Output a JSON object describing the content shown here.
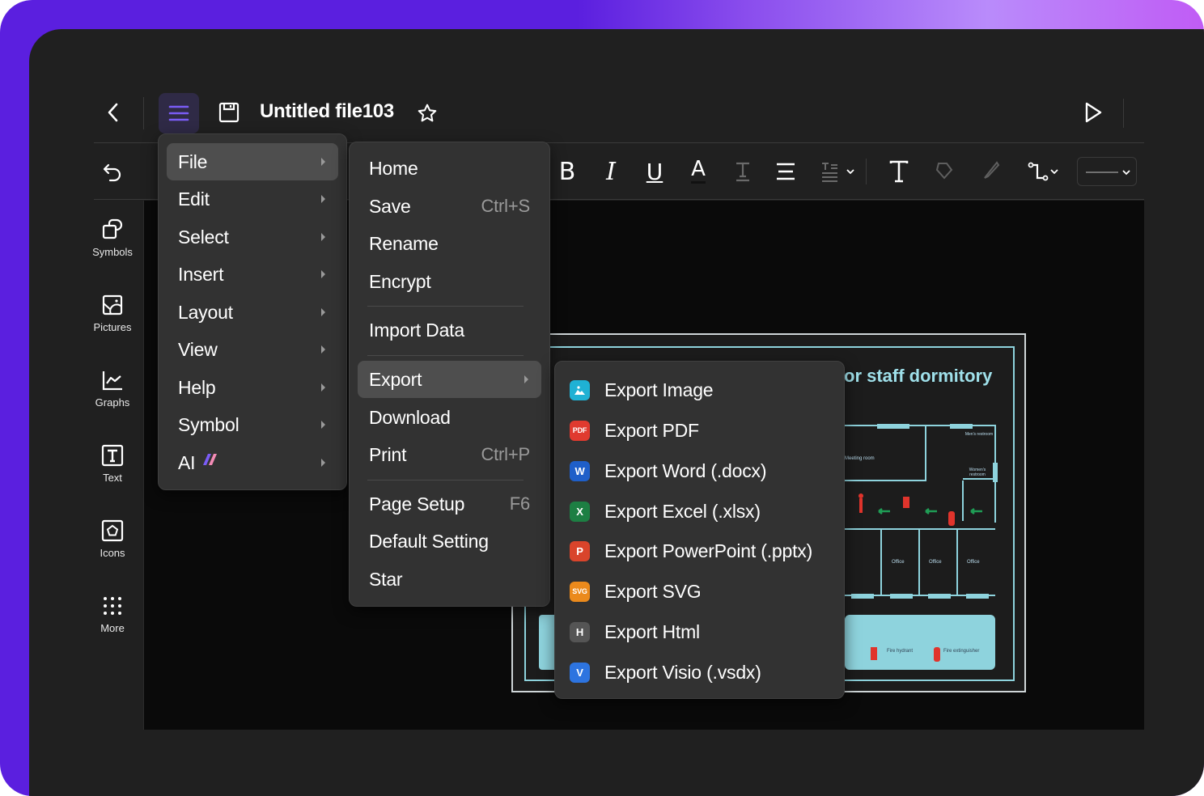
{
  "header": {
    "title": "Untitled file103",
    "icons": [
      "back-icon",
      "menu-icon",
      "save-icon",
      "star-icon",
      "play-icon"
    ]
  },
  "toolbar": {
    "tools": [
      "undo",
      "bold",
      "italic",
      "underline",
      "font-color",
      "text-style",
      "align",
      "line-spacing",
      "text",
      "fill",
      "brush",
      "connector",
      "line-style"
    ],
    "bold_label": "B",
    "italic_label": "I",
    "underline_label": "U",
    "font_color_label": "A",
    "text_label": "T"
  },
  "sidebar": {
    "items": [
      {
        "label": "Symbols",
        "icon": "symbols-icon"
      },
      {
        "label": "Pictures",
        "icon": "pictures-icon"
      },
      {
        "label": "Graphs",
        "icon": "graphs-icon"
      },
      {
        "label": "Text",
        "icon": "text-icon"
      },
      {
        "label": "Icons",
        "icon": "icons-icon"
      },
      {
        "label": "More",
        "icon": "more-icon"
      }
    ]
  },
  "main_menu": {
    "items": [
      {
        "label": "File",
        "active": true
      },
      {
        "label": "Edit"
      },
      {
        "label": "Select"
      },
      {
        "label": "Insert"
      },
      {
        "label": "Layout"
      },
      {
        "label": "View"
      },
      {
        "label": "Help"
      },
      {
        "label": "Symbol"
      },
      {
        "label": "AI"
      }
    ]
  },
  "file_menu": {
    "items": [
      {
        "label": "Home"
      },
      {
        "label": "Save",
        "shortcut": "Ctrl+S"
      },
      {
        "label": "Rename"
      },
      {
        "label": "Encrypt"
      },
      {
        "label": "Import Data"
      },
      {
        "label": "Export",
        "active": true
      },
      {
        "label": "Download"
      },
      {
        "label": "Print",
        "shortcut": "Ctrl+P"
      },
      {
        "label": "Page Setup",
        "shortcut": "F6"
      },
      {
        "label": "Default Setting"
      },
      {
        "label": "Star"
      }
    ]
  },
  "export_menu": {
    "items": [
      {
        "label": "Export Image",
        "badge": "",
        "color": "#1fb1d4"
      },
      {
        "label": "Export PDF",
        "badge": "PDF",
        "color": "#e03a2f"
      },
      {
        "label": "Export Word (.docx)",
        "badge": "W",
        "color": "#1f5fc9"
      },
      {
        "label": "Export Excel (.xlsx)",
        "badge": "X",
        "color": "#1d7f43"
      },
      {
        "label": "Export PowerPoint (.pptx)",
        "badge": "P",
        "color": "#d9442b"
      },
      {
        "label": "Export SVG",
        "badge": "SVG",
        "color": "#eb8a1c"
      },
      {
        "label": "Export Html",
        "badge": "H",
        "color": "#555555"
      },
      {
        "label": "Export Visio (.vsdx)",
        "badge": "V",
        "color": "#2d74e0"
      }
    ]
  },
  "canvas": {
    "document_title_fragment": "or staff dormitory",
    "room_labels": [
      "Men's restroom",
      "Meeting room",
      "Women's restroom",
      "Office",
      "Office",
      "Office",
      "Office"
    ],
    "legend": [
      "Fire hydrant",
      "Fire extinguisher"
    ]
  },
  "colors": {
    "accent": "#6b4ef0",
    "frame_gradient_start": "#5b1fdf",
    "frame_gradient_end": "#c05cf5",
    "app_bg": "#202020",
    "menu_bg": "#323232",
    "menu_active": "#4e4e4e",
    "diagram_stroke": "#8ed3dd"
  }
}
